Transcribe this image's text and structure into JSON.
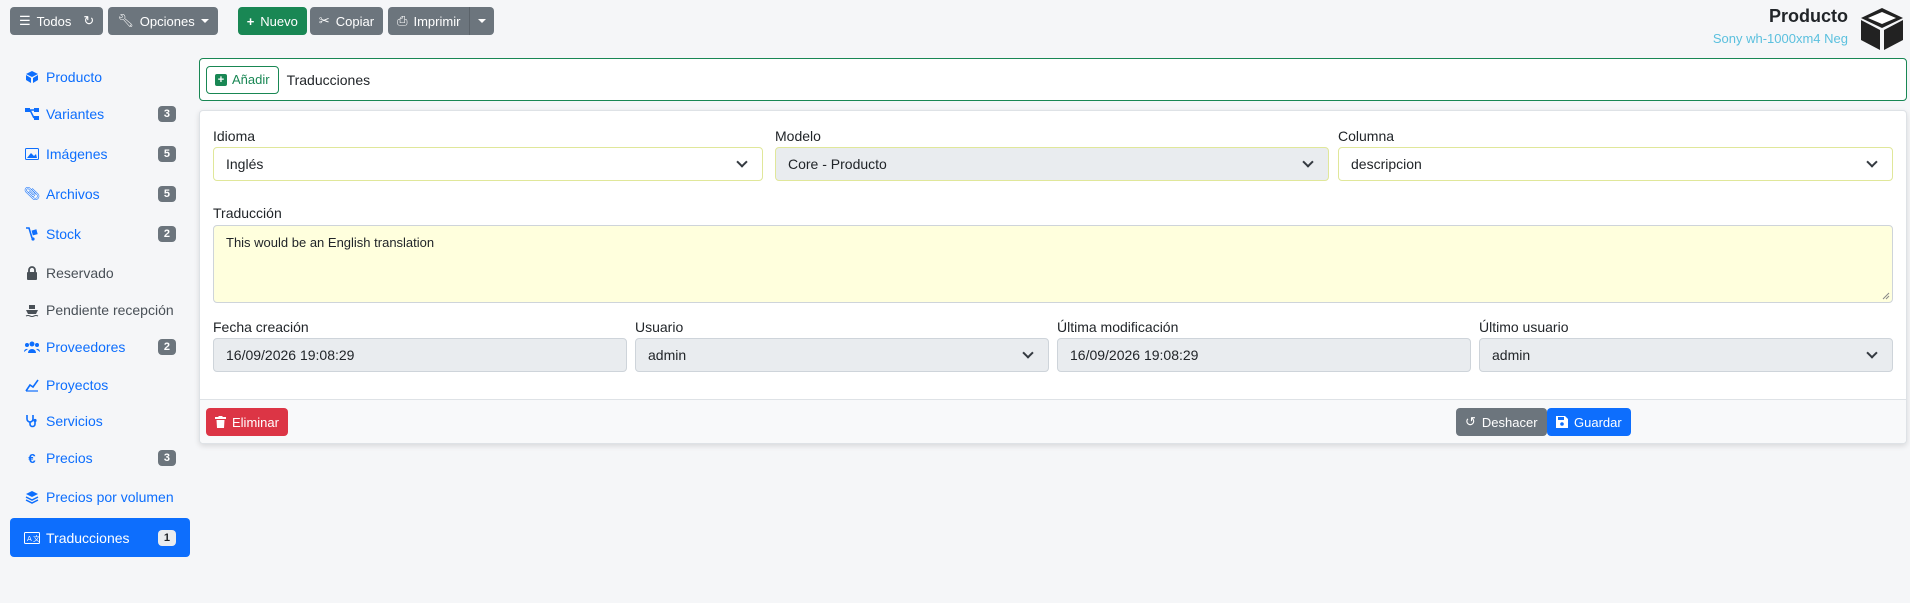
{
  "toolbar": {
    "todos": "Todos",
    "opciones": "Opciones",
    "nuevo": "Nuevo",
    "copiar": "Copiar",
    "imprimir": "Imprimir"
  },
  "header": {
    "title": "Producto",
    "subtitle": "Sony wh-1000xm4 Neg"
  },
  "sidebar": {
    "items": [
      {
        "label": "Producto",
        "icon": "cube-icon",
        "badge": ""
      },
      {
        "label": "Variantes",
        "icon": "sitemap-icon",
        "badge": "3"
      },
      {
        "label": "Imágenes",
        "icon": "images-icon",
        "badge": "5"
      },
      {
        "label": "Archivos",
        "icon": "paperclip-icon",
        "badge": "5"
      },
      {
        "label": "Stock",
        "icon": "dolly-icon",
        "badge": "2"
      },
      {
        "label": "Reservado",
        "icon": "lock-icon",
        "badge": ""
      },
      {
        "label": "Pendiente recepción",
        "icon": "ship-icon",
        "badge": ""
      },
      {
        "label": "Proveedores",
        "icon": "users-icon",
        "badge": "2"
      },
      {
        "label": "Proyectos",
        "icon": "project-icon",
        "badge": ""
      },
      {
        "label": "Servicios",
        "icon": "stethoscope-icon",
        "badge": ""
      },
      {
        "label": "Precios",
        "icon": "euro-icon",
        "badge": "3"
      },
      {
        "label": "Precios por volumen",
        "icon": "layers-icon",
        "badge": ""
      },
      {
        "label": "Traducciones",
        "icon": "language-icon",
        "badge": "1"
      }
    ]
  },
  "tabbar": {
    "add_label": "Añadir",
    "title": "Traducciones"
  },
  "form": {
    "idioma_label": "Idioma",
    "idioma_value": "Inglés",
    "modelo_label": "Modelo",
    "modelo_value": "Core - Producto",
    "columna_label": "Columna",
    "columna_value": "descripcion",
    "traduccion_label": "Traducción",
    "traduccion_value": "This would be an English translation",
    "fecha_creacion_label": "Fecha creación",
    "fecha_creacion_value": "16/09/2026 19:08:29",
    "usuario_label": "Usuario",
    "usuario_value": "admin",
    "ultima_mod_label": "Última modificación",
    "ultima_mod_value": "16/09/2026 19:08:29",
    "ultimo_usuario_label": "Último usuario",
    "ultimo_usuario_value": "admin"
  },
  "footer": {
    "eliminar": "Eliminar",
    "deshacer": "Deshacer",
    "guardar": "Guardar"
  },
  "colors": {
    "primary": "#0d6efd",
    "success": "#198754",
    "danger": "#dc3545",
    "secondary": "#6c757d",
    "textarea_bg": "#ffffdd"
  }
}
